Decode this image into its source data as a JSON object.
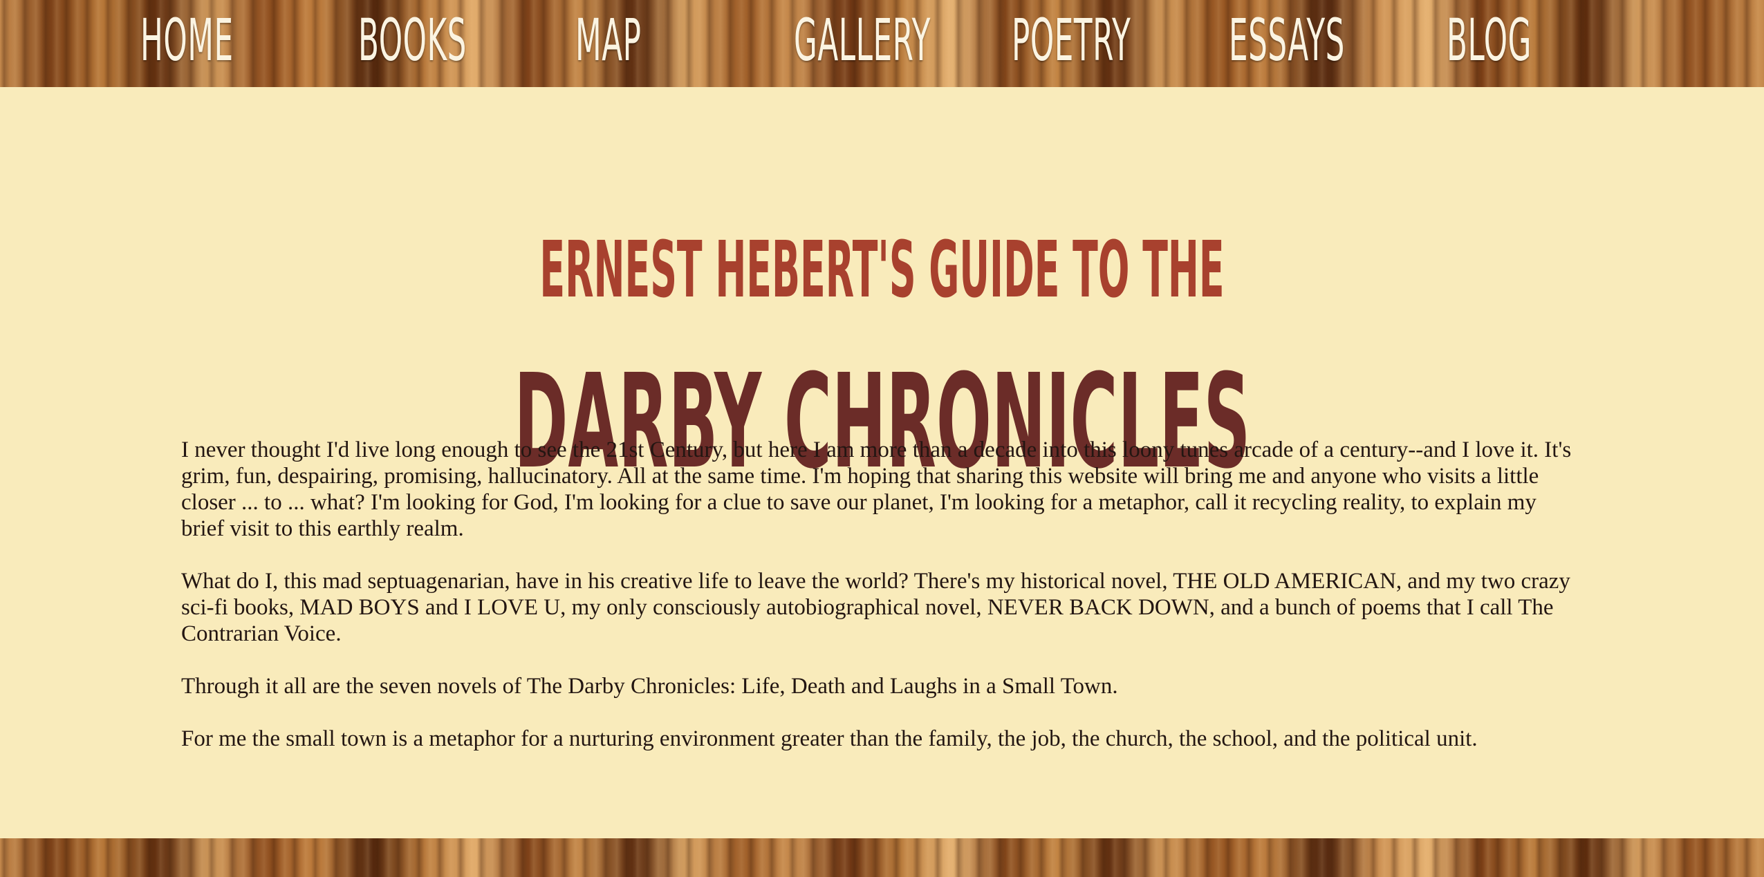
{
  "nav": {
    "items": [
      {
        "label": "HOME"
      },
      {
        "label": "BOOKS"
      },
      {
        "label": "MAP"
      },
      {
        "label": "GALLERY"
      },
      {
        "label": "POETRY"
      },
      {
        "label": "ESSAYS"
      },
      {
        "label": "BLOG"
      }
    ]
  },
  "header": {
    "subtitle": "Ernest Hebert's Guide to the",
    "title": "Darby Chronicles"
  },
  "main": {
    "paragraphs": [
      "I never thought I'd live long enough to see the 21st Century, but here I am more than a decade into this loony tunes arcade of a century--and I love it. It's grim, fun, despairing, promising, hallucinatory. All at the same time. I'm hoping that sharing this website will bring me and anyone who visits a little closer ... to ... what? I'm looking for God, I'm looking for a clue to save our planet, I'm looking for a metaphor, call it recycling reality, to explain my brief visit to this earthly realm.",
      "What do I, this mad septuagenarian, have in his creative life to leave the world? There's my historical novel, THE OLD AMERICAN, and my two crazy sci-fi books, MAD BOYS and I LOVE U, my only consciously autobiographical novel, NEVER BACK DOWN, and a bunch of poems that I call The Contrarian Voice.",
      "Through it all are the seven novels of The Darby Chronicles: Life, Death and Laughs in a Small Town.",
      "For me the small town is a metaphor for a nurturing environment greater than the family, the job, the church, the school, and the political unit."
    ]
  },
  "colors": {
    "background": "#f9ebbb",
    "subtitle": "#a8412e",
    "title": "#6b2c28",
    "nav_text": "#fbf4e2",
    "body_text": "#231612"
  }
}
